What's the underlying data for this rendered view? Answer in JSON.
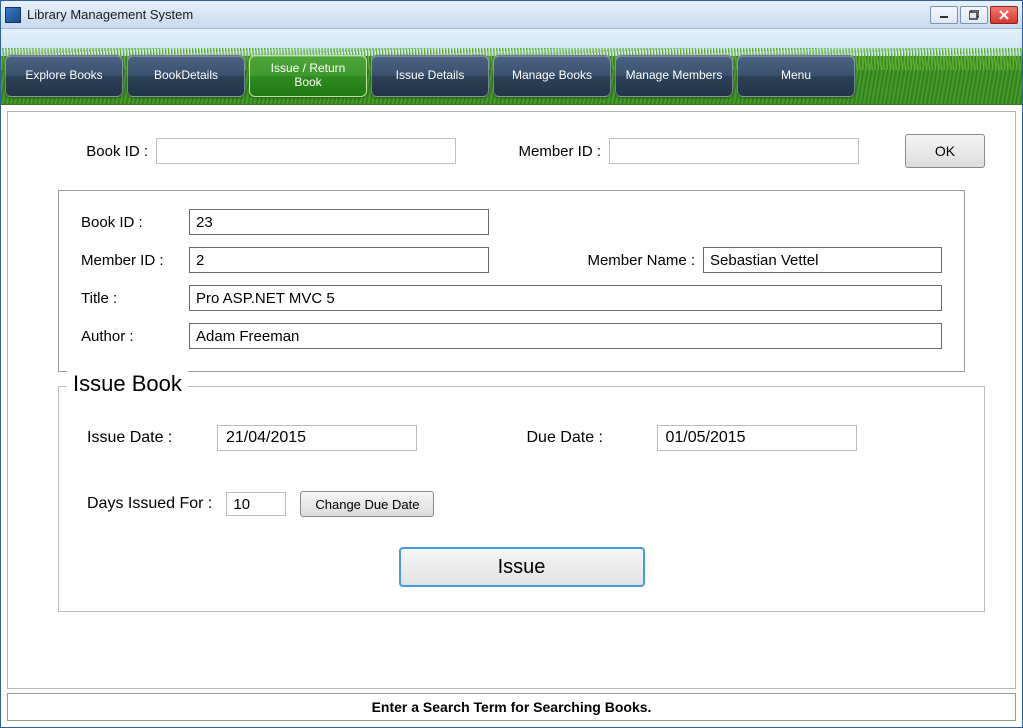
{
  "window": {
    "title": "Library Management System"
  },
  "nav": {
    "items": [
      {
        "label": "Explore Books",
        "active": false
      },
      {
        "label": "BookDetails",
        "active": false
      },
      {
        "label": "Issue / Return Book",
        "active": true
      },
      {
        "label": "Issue Details",
        "active": false
      },
      {
        "label": "Manage Books",
        "active": false
      },
      {
        "label": "Manage Members",
        "active": false
      },
      {
        "label": "Menu",
        "active": false
      }
    ]
  },
  "search": {
    "book_id_label": "Book ID :",
    "book_id_value": "",
    "member_id_label": "Member ID :",
    "member_id_value": "",
    "ok_label": "OK"
  },
  "details": {
    "book_id_label": "Book ID :",
    "book_id_value": "23",
    "member_id_label": "Member ID :",
    "member_id_value": "2",
    "member_name_label": "Member Name :",
    "member_name_value": "Sebastian Vettel",
    "title_label": "Title :",
    "title_value": "Pro ASP.NET MVC 5",
    "author_label": "Author :",
    "author_value": "Adam Freeman"
  },
  "issue": {
    "legend": "Issue Book",
    "issue_date_label": "Issue Date :",
    "issue_date_value": "21/04/2015",
    "due_date_label": "Due Date :",
    "due_date_value": "01/05/2015",
    "days_label": "Days Issued For :",
    "days_value": "10",
    "change_due_label": "Change Due Date",
    "issue_button_label": "Issue"
  },
  "status": {
    "text": "Enter a Search Term for Searching Books."
  }
}
